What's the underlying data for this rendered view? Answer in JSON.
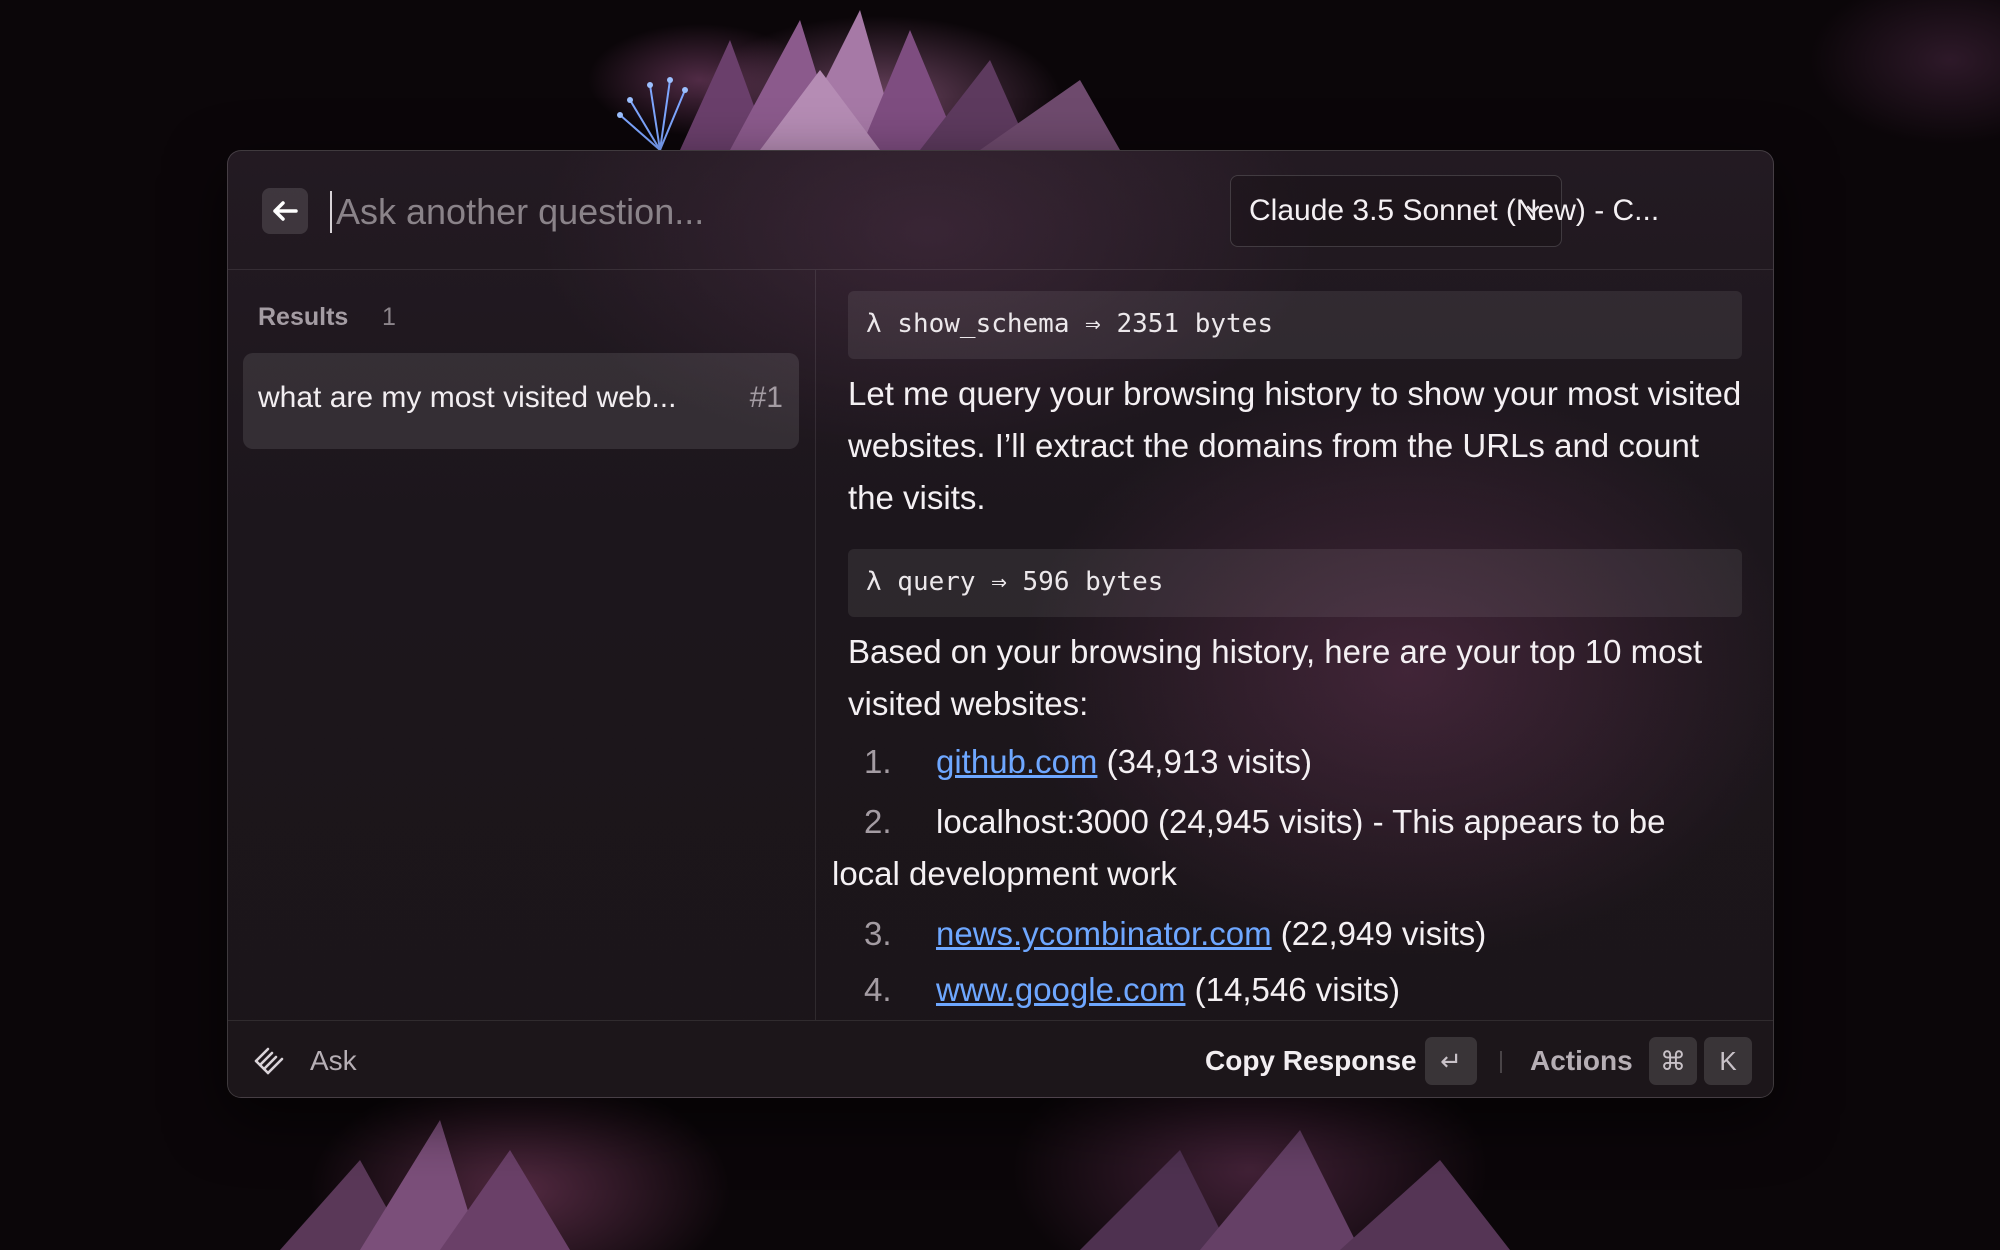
{
  "header": {
    "back_icon": "arrow-left-icon",
    "input_placeholder": "Ask another question...",
    "input_value": "",
    "model_selected": "Claude 3.5 Sonnet (New) - C...",
    "model_chevron_icon": "chevron-down-icon"
  },
  "sidebar": {
    "results_label": "Results",
    "results_count": "1",
    "items": [
      {
        "label": "what are my most visited web...",
        "number": "#1"
      }
    ]
  },
  "response": {
    "tool_calls": [
      {
        "text": "λ show_schema ⇒ 2351 bytes"
      },
      {
        "text": "λ query ⇒ 596 bytes"
      }
    ],
    "paragraphs": [
      "Let me query your browsing history to show your most visited websites. I’ll extract the domains from the URLs and count the visits.",
      "Based on your browsing history, here are your top 10 most visited websites:"
    ],
    "list": [
      {
        "num": "1.",
        "link": "github.com",
        "rest": " (34,913 visits)"
      },
      {
        "num": "2.",
        "text_line1": "localhost:3000 (24,945 visits) - This appears to be",
        "text_line2": "local development work"
      },
      {
        "num": "3.",
        "link": "news.ycombinator.com",
        "rest": " (22,949 visits)"
      },
      {
        "num": "4.",
        "link": "www.google.com",
        "rest": " (14,546 visits)"
      }
    ]
  },
  "footer": {
    "logo_icon": "raycast-logo-icon",
    "ask_label": "Ask",
    "copy_response_label": "Copy Response",
    "enter_key": "↵",
    "actions_label": "Actions",
    "cmd_key": "⌘",
    "k_key": "K"
  },
  "colors": {
    "link": "#6ea7ff",
    "window_bg": "#1c161c",
    "text": "#f2eef1",
    "muted": "#a49ca3"
  }
}
